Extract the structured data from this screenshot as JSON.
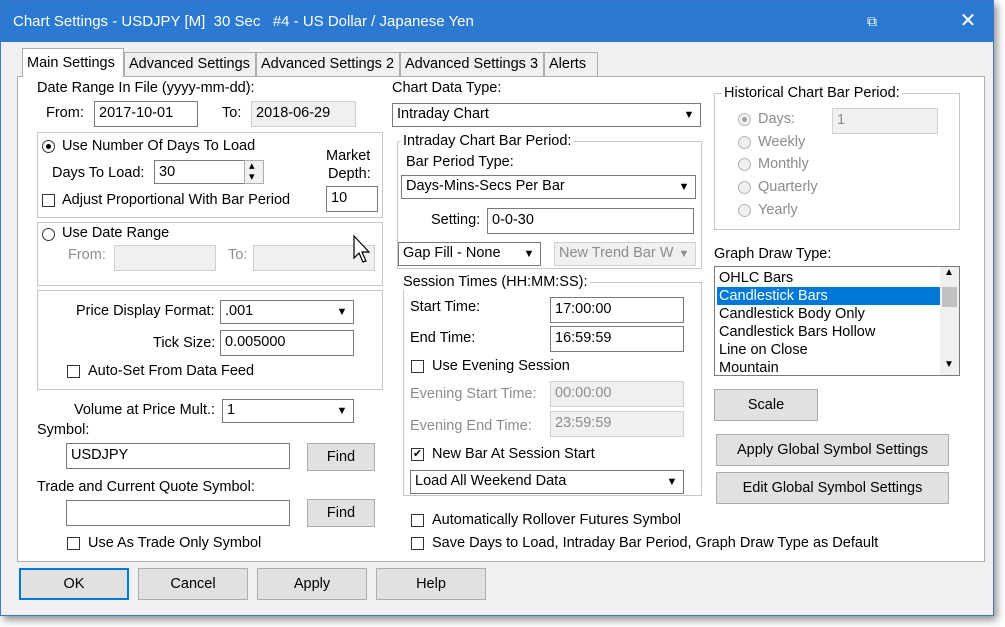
{
  "window": {
    "title": "Chart Settings - USDJPY [M]  30 Sec   #4 - US Dollar / Japanese Yen",
    "close_glyph": "✕",
    "titlebar_icon_glyph": "⧉"
  },
  "tabs": [
    "Main Settings",
    "Advanced Settings",
    "Advanced Settings 2",
    "Advanced Settings 3",
    "Alerts"
  ],
  "date_range": {
    "label": "Date Range In File (yyyy-mm-dd):",
    "from_label": "From:",
    "from_value": "2017-10-01",
    "to_label": "To:",
    "to_value": "2018-06-29"
  },
  "days_group": {
    "use_days_label": "Use Number Of Days To Load",
    "days_to_load_label": "Days To Load:",
    "days_to_load_value": "30",
    "adjust_label": "Adjust Proportional With Bar Period",
    "market_depth_label1": "Market",
    "market_depth_label2": "Depth:",
    "market_depth_value": "10"
  },
  "date_range_group": {
    "use_date_range_label": "Use Date Range",
    "from_label": "From:",
    "to_label": "To:"
  },
  "price_group": {
    "price_format_label": "Price Display Format:",
    "price_format_value": ".001",
    "tick_size_label": "Tick Size:",
    "tick_size_value": "0.005000",
    "auto_set_label": "Auto-Set From Data Feed"
  },
  "volume": {
    "label": "Volume at Price Mult.:",
    "value": "1"
  },
  "symbol": {
    "label": "Symbol:",
    "value": "USDJPY",
    "find_label": "Find"
  },
  "trade_symbol": {
    "label": "Trade and Current Quote Symbol:",
    "value": "",
    "find_label": "Find",
    "trade_only_label": "Use As Trade Only Symbol"
  },
  "chart_data_type": {
    "label": "Chart Data Type:",
    "value": "Intraday Chart"
  },
  "intraday_period": {
    "title": "Intraday Chart Bar Period:",
    "bar_period_type_label": "Bar Period Type:",
    "bar_period_type_value": "Days-Mins-Secs Per Bar",
    "setting_label": "Setting:",
    "setting_value": "0-0-30",
    "gap_fill_value": "Gap Fill - None",
    "new_trend_value": "New Trend Bar W"
  },
  "session": {
    "title": "Session Times (HH:MM:SS):",
    "start_label": "Start Time:",
    "start_value": "17:00:00",
    "end_label": "End Time:",
    "end_value": "16:59:59",
    "use_evening_label": "Use Evening Session",
    "evening_start_label": "Evening Start Time:",
    "evening_start_value": "00:00:00",
    "evening_end_label": "Evening End Time:",
    "evening_end_value": "23:59:59",
    "new_bar_label": "New Bar At Session Start",
    "weekend_value": "Load All Weekend Data"
  },
  "rollover_label": "Automatically Rollover Futures Symbol",
  "save_defaults_label": "Save Days to Load, Intraday Bar Period, Graph Draw Type as Default",
  "historical": {
    "title": "Historical Chart Bar Period:",
    "days_label": "Days:",
    "days_value": "1",
    "weekly_label": "Weekly",
    "monthly_label": "Monthly",
    "quarterly_label": "Quarterly",
    "yearly_label": "Yearly"
  },
  "graph_draw": {
    "label": "Graph Draw Type:",
    "items": [
      "OHLC Bars",
      "Candlestick Bars",
      "Candlestick Body Only",
      "Candlestick Bars Hollow",
      "Line on Close",
      "Mountain"
    ],
    "selected": "Candlestick Bars"
  },
  "buttons": {
    "scale": "Scale",
    "apply_global": "Apply Global Symbol Settings",
    "edit_global": "Edit Global Symbol Settings",
    "ok": "OK",
    "cancel": "Cancel",
    "apply": "Apply",
    "help": "Help"
  },
  "glyphs": {
    "check": "✔",
    "down_arrow": "▼",
    "up_arrow": "▲",
    "spin_up": "▴",
    "spin_down": "▾"
  },
  "colors": {
    "titlebar": "#2b79d0",
    "selection": "#0078d7"
  }
}
